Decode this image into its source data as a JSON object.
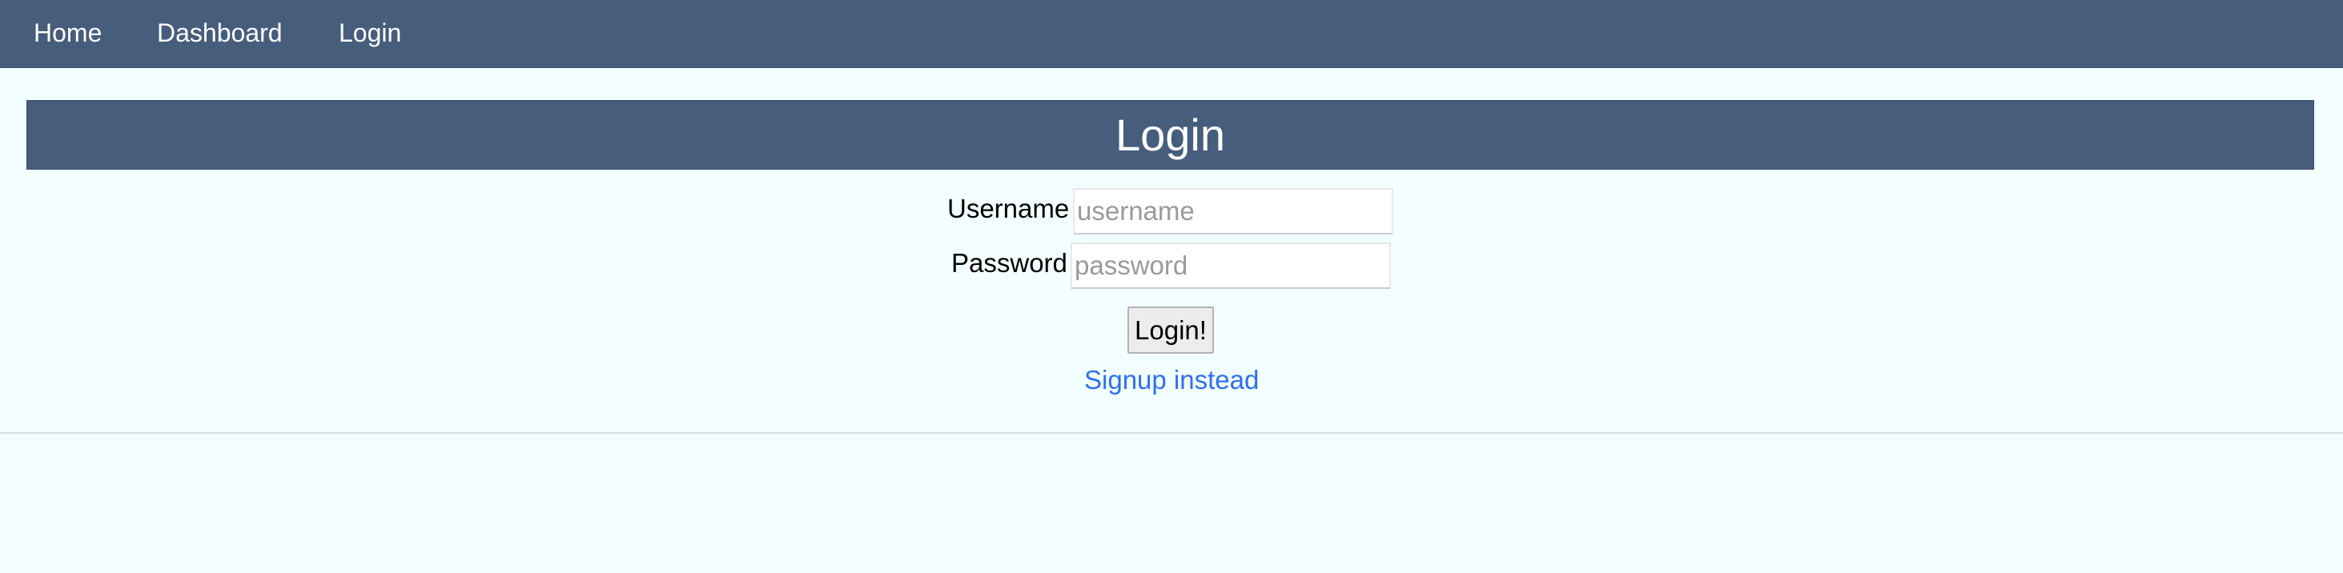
{
  "nav": {
    "items": [
      {
        "label": "Home"
      },
      {
        "label": "Dashboard"
      },
      {
        "label": "Login"
      }
    ]
  },
  "page": {
    "title": "Login"
  },
  "form": {
    "username_label": "Username",
    "username_placeholder": "username",
    "password_label": "Password",
    "password_placeholder": "password",
    "submit_label": "Login!",
    "signup_link": "Signup instead"
  },
  "colors": {
    "nav_background": "#475d7c",
    "page_background": "#f2fffe",
    "link": "#2f6ff0"
  }
}
